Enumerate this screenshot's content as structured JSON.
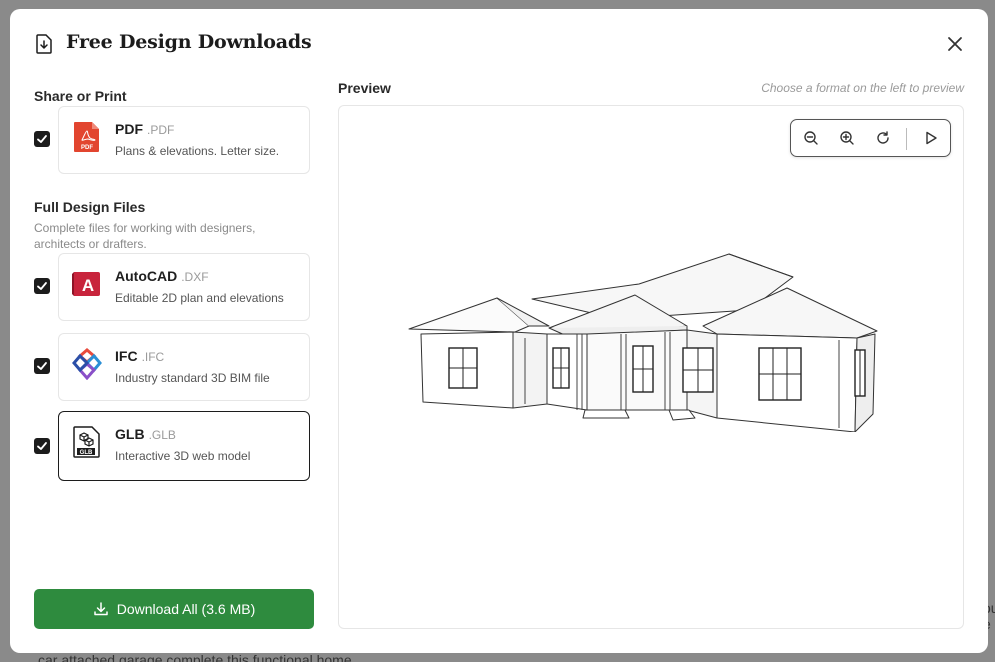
{
  "modal": {
    "title": "Free Design Downloads"
  },
  "backdrop": {
    "text": "car attached garage complete this functional home.",
    "edge_text": "ou e"
  },
  "left": {
    "share_section": {
      "title": "Share or Print"
    },
    "full_section": {
      "title": "Full Design Files",
      "description": "Complete files for working with designers, architects or drafters."
    },
    "formats": [
      {
        "name": "PDF",
        "ext": ".PDF",
        "description": "Plans & elevations. Letter size.",
        "checked": true,
        "icon": "pdf-icon"
      },
      {
        "name": "AutoCAD",
        "ext": ".DXF",
        "description": "Editable 2D plan and elevations",
        "checked": true,
        "icon": "autocad-icon",
        "icon_letter": "A"
      },
      {
        "name": "IFC",
        "ext": ".IFC",
        "description": "Industry standard 3D BIM file",
        "checked": true,
        "icon": "ifc-icon"
      },
      {
        "name": "GLB",
        "ext": ".GLB",
        "description": "Interactive 3D web model",
        "checked": true,
        "selected": true,
        "icon": "glb-icon",
        "icon_label": "GLB"
      }
    ],
    "pdf_icon_label": "PDF",
    "download_label": "Download All (3.6 MB)"
  },
  "preview": {
    "label": "Preview",
    "hint": "Choose a format on the left to preview",
    "toolbar": [
      "zoom-out-icon",
      "zoom-in-icon",
      "reset-icon",
      "play-icon"
    ]
  },
  "colors": {
    "accent_green": "#2e8b3e",
    "pdf_red": "#e2452f",
    "autocad_red": "#c8243c",
    "ink": "#1c1c1c"
  }
}
